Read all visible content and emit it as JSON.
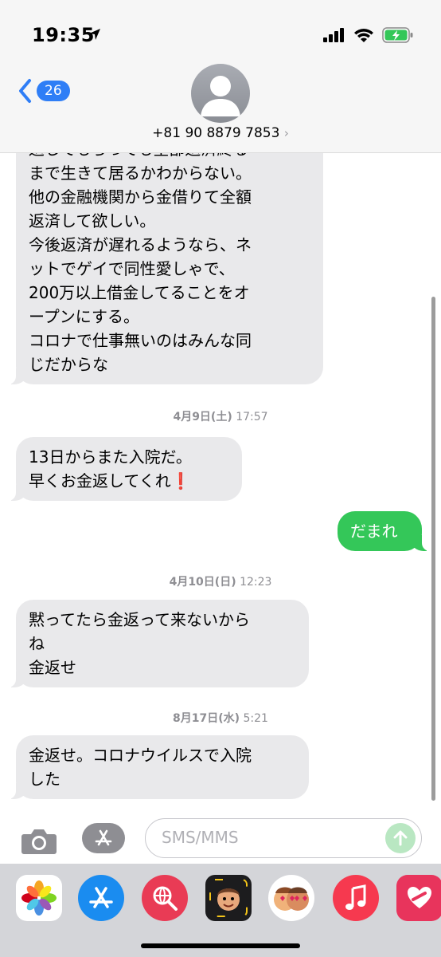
{
  "status_bar": {
    "time": "19:35"
  },
  "nav": {
    "back_count": "26",
    "contact_number": "+81 90 8879 7853",
    "contact_chevron": "›"
  },
  "messages": {
    "m1": {
      "lines": [
        "返してもらっても全部返済終る",
        "まで生きて居るかわからない。",
        "他の金融機関から金借りて全額",
        "返済して欲しい。",
        "今後返済が遅れるようなら、ネ",
        "ットでゲイで同性愛しゃで、",
        "200万以上借金してることをオ",
        "ープンにする。",
        "コロナで仕事無いのはみんな同",
        "じだからな"
      ]
    },
    "stamp1": {
      "date": "4月9日(土)",
      "time": "17:57"
    },
    "m2": {
      "lines": [
        "13日からまた入院だ。",
        "早くお金返してくれ❗"
      ]
    },
    "m3": {
      "lines": [
        "だまれ"
      ]
    },
    "stamp2": {
      "date": "4月10日(日)",
      "time": "12:23"
    },
    "m4": {
      "lines": [
        "黙ってたら金返って来ないから",
        "ね",
        "金返せ"
      ]
    },
    "stamp3": {
      "date": "8月17日(水)",
      "time": "5:21"
    },
    "m5": {
      "lines": [
        "金返せ。コロナウイルスで入院",
        "した"
      ]
    }
  },
  "input": {
    "placeholder": "SMS/MMS"
  },
  "colors": {
    "sent_bubble": "#34c759",
    "received_bubble": "#e9e9eb",
    "accent": "#2f7ef6"
  },
  "app_drawer": {
    "icons": [
      "photos-icon",
      "app-store-icon",
      "search-web-icon",
      "memoji-icon",
      "memoji-stickers-icon",
      "music-icon",
      "heart-app-icon"
    ]
  }
}
